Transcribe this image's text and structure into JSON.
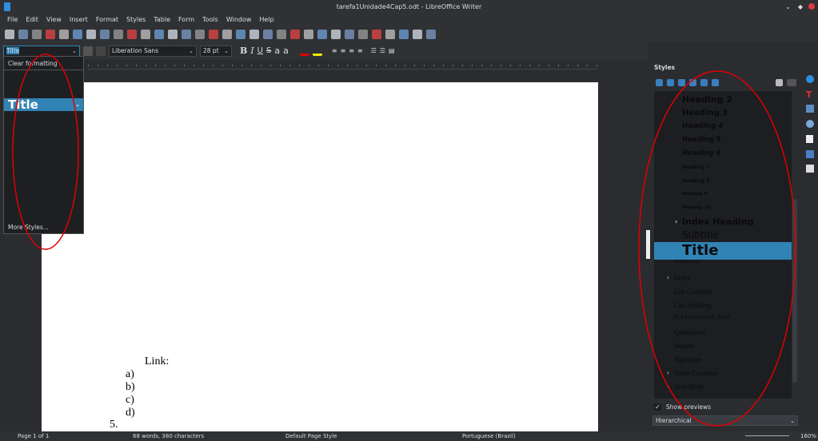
{
  "window": {
    "title": "tarefa1Unidade4Cap5.odt - LibreOffice Writer"
  },
  "menu": [
    "File",
    "Edit",
    "View",
    "Insert",
    "Format",
    "Styles",
    "Table",
    "Form",
    "Tools",
    "Window",
    "Help"
  ],
  "formatting": {
    "paragraph_style": "Title",
    "font_name": "Liberation Sans",
    "font_size": "28 pt"
  },
  "style_dropdown": {
    "clear": "Clear formatting",
    "current": "Title",
    "more": "More Styles..."
  },
  "document": {
    "lines": [
      "Link:",
      "a)",
      "b)",
      "c)",
      "d)",
      "5."
    ]
  },
  "sidebar": {
    "title": "Styles",
    "styles": [
      {
        "label": "Heading 2",
        "size": 11,
        "italic": false
      },
      {
        "label": "Heading 3",
        "size": 10,
        "italic": false
      },
      {
        "label": "Heading 4",
        "size": 9,
        "italic": true
      },
      {
        "label": "Heading 5",
        "size": 8.5,
        "italic": false
      },
      {
        "label": "Heading 6",
        "size": 8.5,
        "italic": true
      },
      {
        "label": "Heading 7",
        "size": 6,
        "italic": false
      },
      {
        "label": "Heading 8",
        "size": 6,
        "italic": true
      },
      {
        "label": "Heading 9",
        "size": 5.5,
        "italic": false
      },
      {
        "label": "Heading 10",
        "size": 5.5,
        "italic": false
      },
      {
        "label": "Index Heading",
        "size": 11,
        "italic": false,
        "expander": true
      },
      {
        "label": "Subtitle",
        "size": 12,
        "italic": false,
        "light": true
      },
      {
        "label": "Title",
        "size": 18,
        "italic": false,
        "selected": true
      }
    ],
    "styles_lower": [
      {
        "label": "Horizontal Line",
        "small": true
      },
      {
        "label": "Index",
        "expander": true
      },
      {
        "label": "List Contents"
      },
      {
        "label": "List Heading"
      },
      {
        "label": "Preformatted Text",
        "mono": true
      },
      {
        "label": "Quotations"
      },
      {
        "label": "Sender"
      },
      {
        "label": "Signature"
      },
      {
        "label": "Table Contents",
        "expander": true
      },
      {
        "label": "Text Body",
        "expander": true
      }
    ],
    "show_previews": "Show previews",
    "filter": "Hierarchical"
  },
  "status": {
    "page": "Page 1 of 1",
    "words": "68 words, 380 characters",
    "page_style": "Default Page Style",
    "language": "Portuguese (Brazil)",
    "zoom": "160%"
  },
  "colors": {
    "accent": "#3183b5",
    "annotation": "#e00000"
  }
}
